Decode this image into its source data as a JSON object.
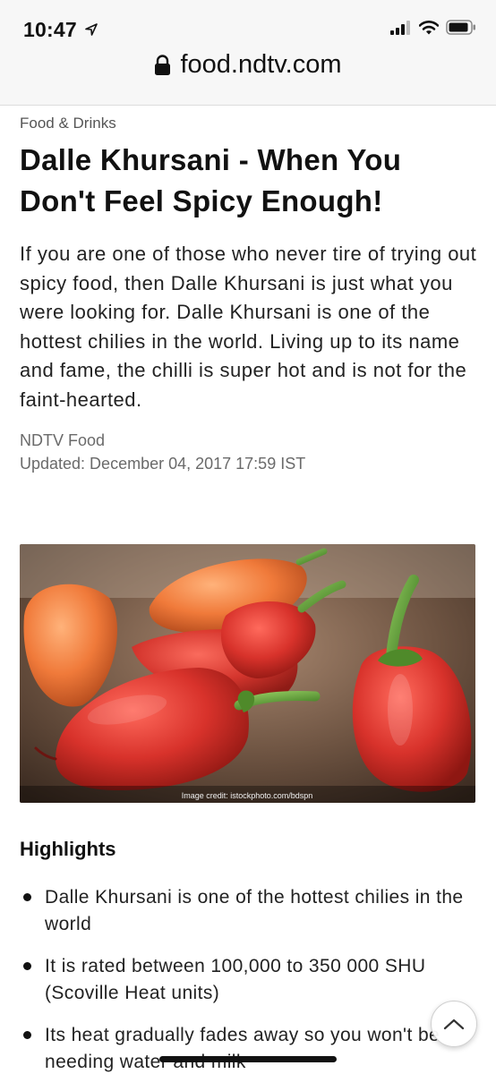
{
  "status_bar": {
    "time": "10:47"
  },
  "browser": {
    "url": "food.ndtv.com"
  },
  "article": {
    "category": "Food & Drinks",
    "headline": "Dalle Khursani - When You Don't Feel Spicy Enough!",
    "summary": "If you are one of those who never tire of trying out spicy food, then Dalle Khursani is just what you were looking for. Dalle Khursani is one of the hottest chilies in the world. Living up to its name and fame, the chilli is super hot and is not for the faint-hearted.",
    "author": "NDTV Food",
    "updated": "Updated: December 04, 2017 17:59 IST",
    "image_credit": "Image credit: istockphoto.com/bdspn"
  },
  "highlights": {
    "title": "Highlights",
    "items": [
      "Dalle Khursani is one of the hottest chilies in the world",
      "It is rated between 100,000 to 350 000 SHU (Scoville Heat units)",
      "Its heat gradually fades away so you won't be needing water and milk"
    ]
  },
  "icons": {
    "location": "location-arrow-icon",
    "signal": "cellular-signal-icon",
    "wifi": "wifi-icon",
    "battery": "battery-icon",
    "lock": "lock-icon",
    "scroll_top": "chevron-up-icon"
  },
  "colors": {
    "chrome_bg": "#f7f7f7",
    "text": "#111111",
    "meta_text": "#6a6a6a",
    "chili_red": "#d8322b",
    "chili_orange": "#f07a3a",
    "stem_green": "#5c9a35"
  }
}
